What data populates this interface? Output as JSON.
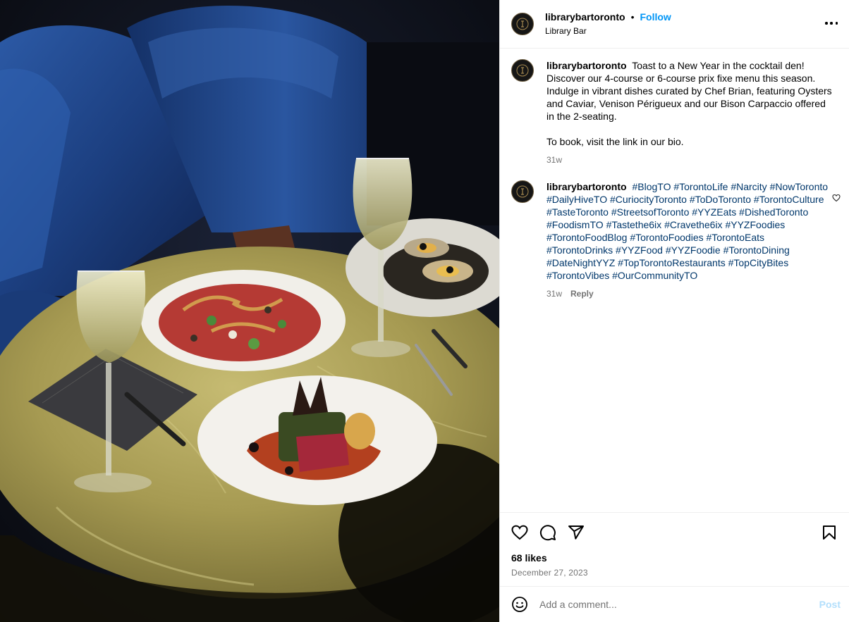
{
  "post": {
    "username": "librarybartoronto",
    "follow_label": "Follow",
    "separator": "•",
    "location": "Library Bar",
    "more_icon": "more-options-icon",
    "photo": {
      "alt": "Two plates of food and champagne glasses on a marble table in front of blue velvet chairs"
    }
  },
  "caption": {
    "username": "librarybartoronto",
    "text": "Toast to a New Year in the cocktail den! Discover our 4-course or 6-course prix fixe menu this season. Indulge in vibrant dishes curated by Chef Brian, featuring Oysters and Caviar, Venison Périgueux and our Bison Carpaccio offered in the 2-seating.\n\nTo book, visit the link in our bio.",
    "time": "31w"
  },
  "comment": {
    "username": "librarybartoronto",
    "hashtags": [
      "#BlogTO",
      "#TorontoLife",
      "#Narcity",
      "#NowToronto",
      "#DailyHiveTO",
      "#CuriocityToronto",
      "#ToDoToronto",
      "#TorontoCulture",
      "#TasteToronto",
      "#StreetsofToronto",
      "#YYZEats",
      "#DishedToronto",
      "#FoodismTO",
      "#Tastethe6ix",
      "#Cravethe6ix",
      "#YYZFoodies",
      "#TorontoFoodBlog",
      "#TorontoFoodies",
      "#TorontoEats",
      "#TorontoDrinks",
      "#YYZFood",
      "#YYZFoodie",
      "#TorontoDining",
      "#DateNightYYZ",
      "#TopTorontoRestaurants",
      "#TopCityBites",
      "#TorontoVibes",
      "#OurCommunityTO"
    ],
    "time": "31w",
    "reply_label": "Reply"
  },
  "actions": {
    "likes": "68 likes",
    "date": "December 27, 2023"
  },
  "add_comment": {
    "placeholder": "Add a comment...",
    "post_label": "Post"
  },
  "colors": {
    "follow": "#0095f6",
    "hashtag": "#00376b",
    "muted": "#737373",
    "post_disabled": "#b2dffc"
  }
}
